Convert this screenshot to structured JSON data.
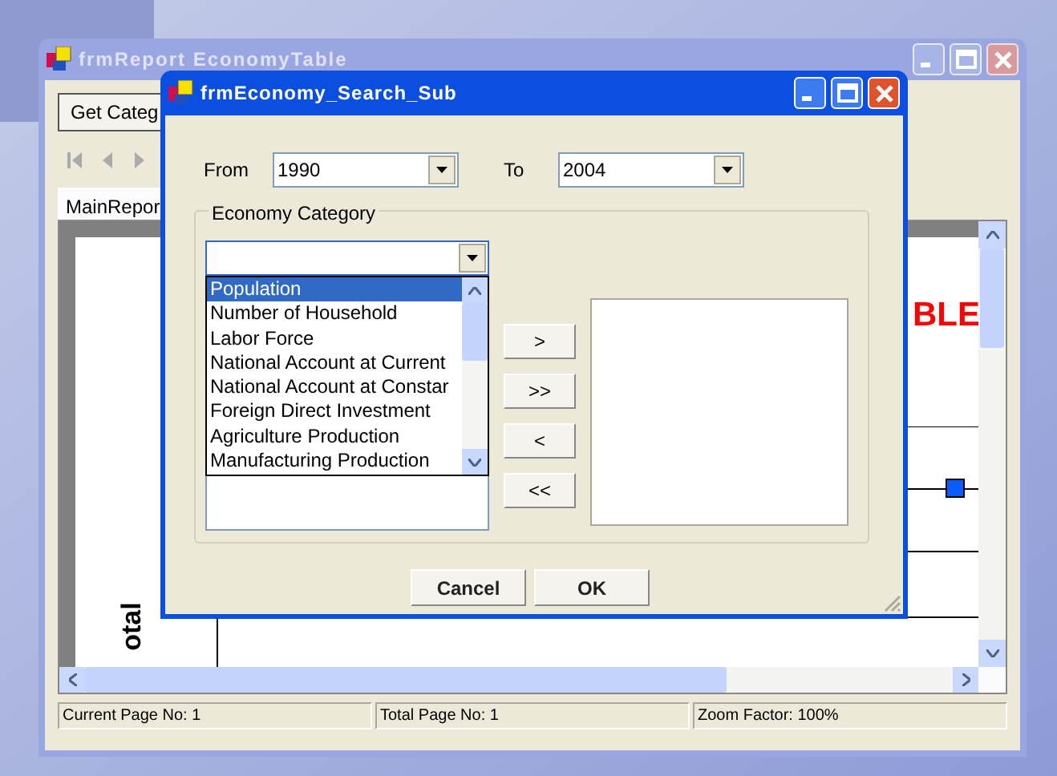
{
  "main_window": {
    "title": "frmReport EconomyTable",
    "active": false,
    "get_button": "Get Categ",
    "tab": {
      "label": "MainRepor",
      "selected": true
    },
    "report": {
      "title_fragment": "BLE",
      "axis_label_fragment": "otal"
    },
    "status_bar": [
      "Current Page No: 1",
      "Total Page No: 1",
      "Zoom Factor: 100%"
    ]
  },
  "dialog": {
    "title": "frmEconomy_Search_Sub",
    "active": true,
    "from_label": "From",
    "from_value": "1990",
    "to_label": "To",
    "to_value": "2004",
    "group_title": "Economy Category",
    "category_combo": {
      "expanded": true
    },
    "options": [
      {
        "label": "Population",
        "selected": true
      },
      {
        "label": "Number of Household",
        "selected": false
      },
      {
        "label": "Labor Force",
        "selected": false
      },
      {
        "label": "National Account at Current",
        "selected": false
      },
      {
        "label": "National Account at Constar",
        "selected": false
      },
      {
        "label": "Foreign Direct Investment",
        "selected": false
      },
      {
        "label": "Agriculture Production",
        "selected": false
      },
      {
        "label": "Manufacturing Production",
        "selected": false
      }
    ],
    "move_buttons": [
      ">",
      ">>",
      "<",
      "<<"
    ],
    "buttons": [
      "Cancel",
      "OK"
    ]
  }
}
